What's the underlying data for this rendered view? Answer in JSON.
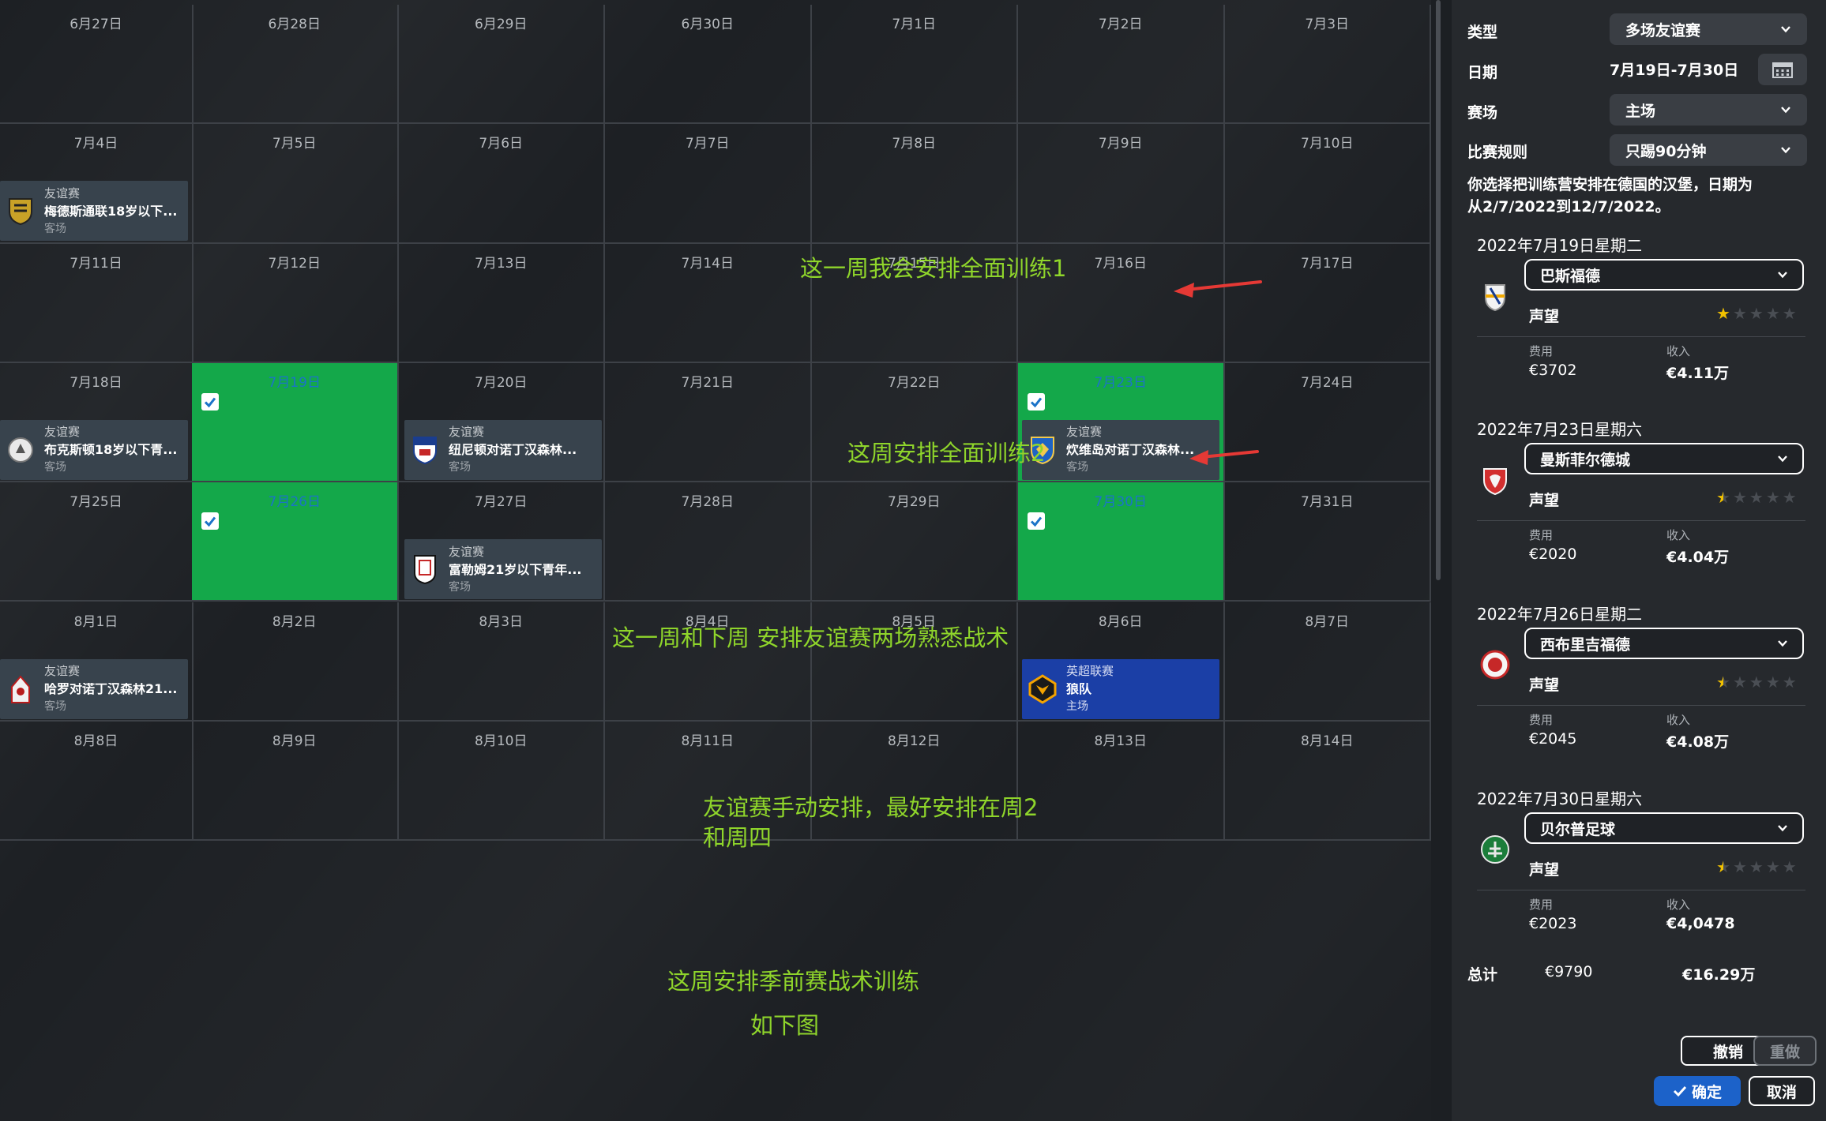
{
  "calendar": {
    "rows": [
      [
        "6月27日",
        "6月28日",
        "6月29日",
        "6月30日",
        "7月1日",
        "7月2日",
        "7月3日"
      ],
      [
        "7月4日",
        "7月5日",
        "7月6日",
        "7月7日",
        "7月8日",
        "7月9日",
        "7月10日"
      ],
      [
        "7月11日",
        "7月12日",
        "7月13日",
        "7月14日",
        "7月15日",
        "7月16日",
        "7月17日"
      ],
      [
        "7月18日",
        "7月19日",
        "7月20日",
        "7月21日",
        "7月22日",
        "7月23日",
        "7月24日"
      ],
      [
        "7月25日",
        "7月26日",
        "7月27日",
        "7月28日",
        "7月29日",
        "7月30日",
        "7月31日"
      ],
      [
        "8月1日",
        "8月2日",
        "8月3日",
        "8月4日",
        "8月5日",
        "8月6日",
        "8月7日"
      ],
      [
        "8月8日",
        "8月9日",
        "8月10日",
        "8月11日",
        "8月12日",
        "8月13日",
        "8月14日"
      ]
    ],
    "selected_days": [
      "7月19日",
      "7月23日",
      "7月26日",
      "7月30日"
    ],
    "events": [
      {
        "type": "友谊赛",
        "name": "梅德斯通联18岁以下...",
        "venue": "客场",
        "crest": "maidstone-crest-icon"
      },
      {
        "type": "友谊赛",
        "name": "布克斯顿18岁以下青...",
        "venue": "客场",
        "crest": "buxton-crest-icon"
      },
      {
        "type": "友谊赛",
        "name": "纽尼顿对诺丁汉森林...",
        "venue": "客场",
        "crest": "nuneaton-crest-icon"
      },
      {
        "type": "友谊赛",
        "name": "炊维岛对诺丁汉森林...",
        "venue": "客场",
        "crest": "team-crest-icon"
      },
      {
        "type": "友谊赛",
        "name": "富勒姆21岁以下青年...",
        "venue": "客场",
        "crest": "fulham-crest-icon"
      },
      {
        "type": "友谊赛",
        "name": "哈罗对诺丁汉森林21...",
        "venue": "客场",
        "crest": "harrow-crest-icon"
      },
      {
        "type": "英超联赛",
        "name": "狼队",
        "venue": "主场",
        "crest": "wolves-crest-icon"
      }
    ],
    "annotations": [
      "这一周我会安排全面训练1",
      "这周安排全面训练2",
      "这一周和下周 安排友谊赛两场熟悉战术",
      "友谊赛手动安排，最好安排在周2",
      "和周四",
      "这周安排季前赛战术训练",
      "如下图"
    ],
    "colors": {
      "selected": "#14a84a",
      "event": "#38434d",
      "league_event": "#1b3fa6",
      "annotation": "#8fd52b",
      "arrow": "#e53935"
    }
  },
  "panel": {
    "type_label": "类型",
    "type_value": "多场友谊赛",
    "date_label": "日期",
    "date_value": "7月19日-7月30日",
    "venue_label": "赛场",
    "venue_value": "主场",
    "rules_label": "比赛规则",
    "rules_value": "只踢90分钟",
    "info_line1": "你选择把训练营安排在德国的汉堡，日期为",
    "info_line2": "从2/7/2022到12/7/2022。",
    "matches": [
      {
        "date": "2022年7月19日星期二",
        "opponent": "巴斯福德",
        "rep_label": "声望",
        "rep_stars": 1,
        "fee_label": "费用",
        "fee": "€3702",
        "income_label": "收入",
        "income": "€4.11万",
        "crest": "basford-crest-icon"
      },
      {
        "date": "2022年7月23日星期六",
        "opponent": "曼斯菲尔德城",
        "rep_label": "声望",
        "rep_stars": 0.5,
        "fee_label": "费用",
        "fee": "€2020",
        "income_label": "收入",
        "income": "€4.04万",
        "crest": "mansfield-crest-icon"
      },
      {
        "date": "2022年7月26日星期二",
        "opponent": "西布里吉福德",
        "rep_label": "声望",
        "rep_stars": 0.5,
        "fee_label": "费用",
        "fee": "€2045",
        "income_label": "收入",
        "income": "€4.08万",
        "crest": "west-bridgford-crest-icon"
      },
      {
        "date": "2022年7月30日星期六",
        "opponent": "贝尔普足球",
        "rep_label": "声望",
        "rep_stars": 0.5,
        "fee_label": "费用",
        "fee": "€2023",
        "income_label": "收入",
        "income": "€4,0478",
        "crest": "belper-crest-icon"
      }
    ],
    "total_label": "总计",
    "total_fee": "€9790",
    "total_income": "€16.29万",
    "undo_label": "撤销",
    "redo_label": "重做",
    "confirm_label": "确定",
    "cancel_label": "取消"
  }
}
